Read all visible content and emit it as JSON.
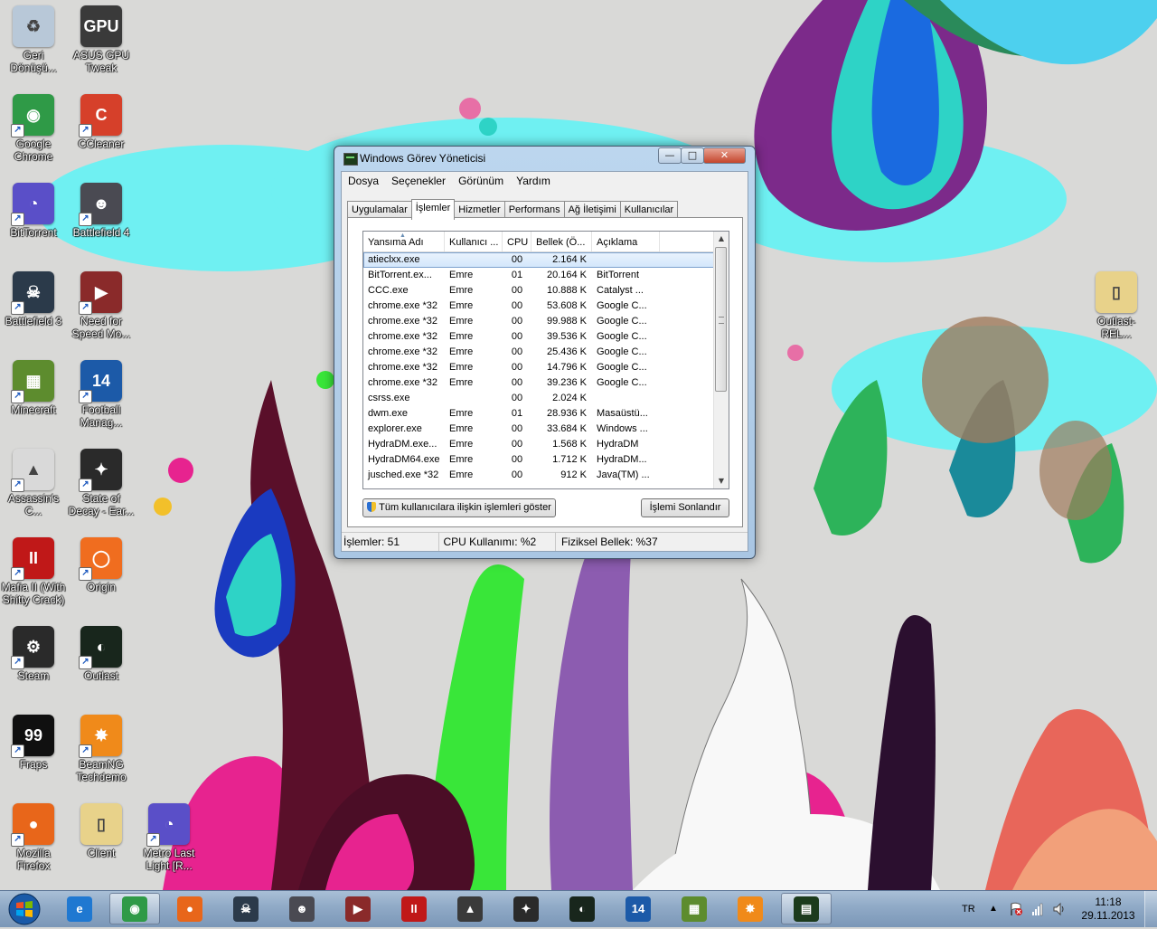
{
  "desktop": {
    "icons": [
      {
        "label": "Geri Dönüşü...",
        "icon": "recycle-bin-icon",
        "color": "#b8c8d8"
      },
      {
        "label": "ASUS GPU Tweak",
        "icon": "asus-gpu-icon",
        "color": "#3a3a3a"
      },
      {
        "label": "Google Chrome",
        "icon": "chrome-icon",
        "color": "#2f9a47"
      },
      {
        "label": "CCleaner",
        "icon": "ccleaner-icon",
        "color": "#d6402a"
      },
      {
        "label": "BitTorrent",
        "icon": "bittorrent-icon",
        "color": "#5a4fc8"
      },
      {
        "label": "Battlefield 4",
        "icon": "battlefield4-icon",
        "color": "#4a4a52"
      },
      {
        "label": "Battlefield 3",
        "icon": "battlefield3-icon",
        "color": "#2b3a4a"
      },
      {
        "label": "Need for Speed Mo...",
        "icon": "nfs-icon",
        "color": "#8a2a2a"
      },
      {
        "label": "Minecraft",
        "icon": "minecraft-icon",
        "color": "#5d8c2e"
      },
      {
        "label": "Football Manag...",
        "icon": "football-manager-icon",
        "color": "#1c5aa8"
      },
      {
        "label": "Assassin's C...",
        "icon": "assassins-creed-icon",
        "color": "#d9d9d9"
      },
      {
        "label": "State of Decay - Ear...",
        "icon": "state-of-decay-icon",
        "color": "#2a2a2a"
      },
      {
        "label": "Mafia II (With Shitty Crack)",
        "icon": "mafia-icon",
        "color": "#c01818"
      },
      {
        "label": "Origin",
        "icon": "origin-icon",
        "color": "#f06d1f"
      },
      {
        "label": "Steam",
        "icon": "steam-icon",
        "color": "#2a2a2a"
      },
      {
        "label": "Outlast",
        "icon": "outlast-icon",
        "color": "#18261c"
      },
      {
        "label": "Fraps",
        "icon": "fraps-icon",
        "color": "#101010"
      },
      {
        "label": "BeamNG Techdemo",
        "icon": "beamng-icon",
        "color": "#f08a1a"
      },
      {
        "label": "Mozilla Firefox",
        "icon": "firefox-icon",
        "color": "#e8661a"
      },
      {
        "label": "Client",
        "icon": "folder-icon",
        "color": "#e8d28a"
      },
      {
        "label": "Metro Last Light [R...",
        "icon": "metro-icon",
        "color": "#5a4fc8"
      },
      {
        "label": "Outlast-REL...",
        "icon": "folder-icon",
        "color": "#e8d28a"
      }
    ],
    "partial_labels": {
      "gpu_badge": "GPU"
    }
  },
  "window": {
    "title": "Windows Görev Yöneticisi",
    "controls": {
      "minimize": "—",
      "maximize": "□",
      "close": "✕"
    },
    "menu": [
      "Dosya",
      "Seçenekler",
      "Görünüm",
      "Yardım"
    ],
    "tabs": [
      "Uygulamalar",
      "İşlemler",
      "Hizmetler",
      "Performans",
      "Ağ İletişimi",
      "Kullanıcılar"
    ],
    "active_tab": 1,
    "columns": [
      "Yansıma Adı",
      "Kullanıcı ...",
      "CPU",
      "Bellek (Ö...",
      "Açıklama"
    ],
    "rows": [
      {
        "name": "atieclxx.exe",
        "user": "",
        "cpu": "00",
        "mem": "2.164 K",
        "desc": "",
        "selected": true
      },
      {
        "name": "BitTorrent.ex...",
        "user": "Emre",
        "cpu": "01",
        "mem": "20.164 K",
        "desc": "BitTorrent"
      },
      {
        "name": "CCC.exe",
        "user": "Emre",
        "cpu": "00",
        "mem": "10.888 K",
        "desc": "Catalyst ..."
      },
      {
        "name": "chrome.exe *32",
        "user": "Emre",
        "cpu": "00",
        "mem": "53.608 K",
        "desc": "Google C..."
      },
      {
        "name": "chrome.exe *32",
        "user": "Emre",
        "cpu": "00",
        "mem": "99.988 K",
        "desc": "Google C..."
      },
      {
        "name": "chrome.exe *32",
        "user": "Emre",
        "cpu": "00",
        "mem": "39.536 K",
        "desc": "Google C..."
      },
      {
        "name": "chrome.exe *32",
        "user": "Emre",
        "cpu": "00",
        "mem": "25.436 K",
        "desc": "Google C..."
      },
      {
        "name": "chrome.exe *32",
        "user": "Emre",
        "cpu": "00",
        "mem": "14.796 K",
        "desc": "Google C..."
      },
      {
        "name": "chrome.exe *32",
        "user": "Emre",
        "cpu": "00",
        "mem": "39.236 K",
        "desc": "Google C..."
      },
      {
        "name": "csrss.exe",
        "user": "",
        "cpu": "00",
        "mem": "2.024 K",
        "desc": ""
      },
      {
        "name": "dwm.exe",
        "user": "Emre",
        "cpu": "01",
        "mem": "28.936 K",
        "desc": "Masaüstü..."
      },
      {
        "name": "explorer.exe",
        "user": "Emre",
        "cpu": "00",
        "mem": "33.684 K",
        "desc": "Windows ..."
      },
      {
        "name": "HydraDM.exe...",
        "user": "Emre",
        "cpu": "00",
        "mem": "1.568 K",
        "desc": "HydraDM"
      },
      {
        "name": "HydraDM64.exe",
        "user": "Emre",
        "cpu": "00",
        "mem": "1.712 K",
        "desc": "HydraDM..."
      },
      {
        "name": "jusched.exe *32",
        "user": "Emre",
        "cpu": "00",
        "mem": "912 K",
        "desc": "Java(TM) ..."
      }
    ],
    "show_all_button": "Tüm kullanıcılara ilişkin işlemleri göster",
    "end_process_button": "İşlemi Sonlandır",
    "status": {
      "processes": "İşlemler: 51",
      "cpu": "CPU Kullanımı: %2",
      "memory": "Fiziksel Bellek: %37"
    }
  },
  "taskbar": {
    "pinned": [
      {
        "icon": "internet-explorer-icon",
        "color": "#1f78d1",
        "glyph": "e"
      },
      {
        "icon": "chrome-icon",
        "color": "#2f9a47",
        "glyph": "◉"
      },
      {
        "icon": "firefox-icon",
        "color": "#e8661a",
        "glyph": "●"
      },
      {
        "icon": "battlefield3-icon",
        "color": "#2b3a4a",
        "glyph": "☠"
      },
      {
        "icon": "battlefield4-icon",
        "color": "#4a4a52",
        "glyph": "☻"
      },
      {
        "icon": "nfs-icon",
        "color": "#8a2a2a",
        "glyph": "▶"
      },
      {
        "icon": "mafia-icon",
        "color": "#c01818",
        "glyph": "II"
      },
      {
        "icon": "assassins-creed-icon",
        "color": "#3a3a3a",
        "glyph": "▲"
      },
      {
        "icon": "state-of-decay-icon",
        "color": "#2a2a2a",
        "glyph": "✦"
      },
      {
        "icon": "outlast-icon",
        "color": "#18261c",
        "glyph": "◐"
      },
      {
        "icon": "football-manager-icon",
        "color": "#1c5aa8",
        "glyph": "14"
      },
      {
        "icon": "minecraft-icon",
        "color": "#5d8c2e",
        "glyph": "▦"
      },
      {
        "icon": "beamng-icon",
        "color": "#f08a1a",
        "glyph": "✸"
      },
      {
        "icon": "task-manager-icon",
        "color": "#1c3b1c",
        "glyph": "▤"
      }
    ],
    "language": "TR",
    "time": "11:18",
    "date": "29.11.2013"
  }
}
